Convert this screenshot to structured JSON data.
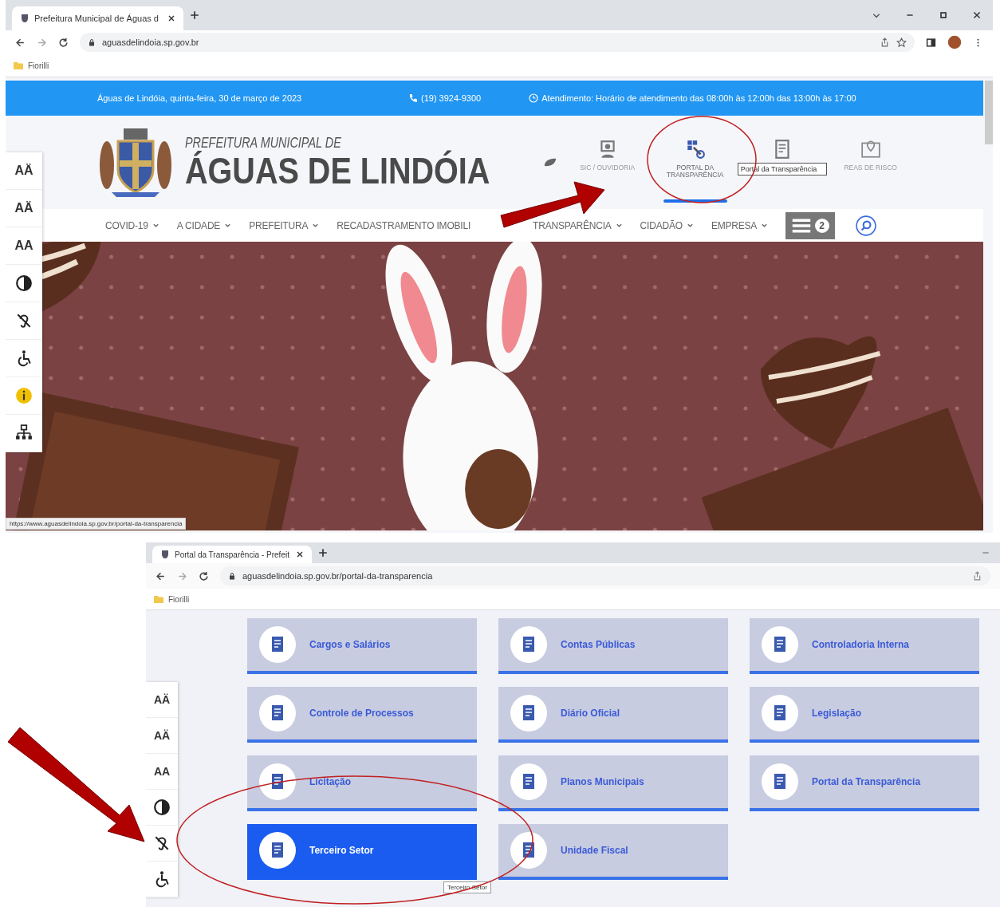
{
  "top_window": {
    "tab": {
      "title": "Prefeitura Municipal de Águas d"
    },
    "address_bar": {
      "url": "aguasdelindoia.sp.gov.br"
    },
    "bookmarks": [
      {
        "label": "Fiorilli"
      }
    ],
    "info_bar": {
      "date": "Águas de Lindóia, quinta-feira, 30 de março de 2023",
      "phone": "(19) 3924-9300",
      "hours": "Atendimento: Horário de atendimento das 08:00h às 12:00h das 13:00h às 17:00"
    },
    "site_header": {
      "title_small": "PREFEITURA MUNICIPAL DE",
      "title_large": "ÁGUAS DE LINDÓIA",
      "shortcuts": [
        {
          "kind": "headset",
          "label": "SIC / OUVIDORIA",
          "selected": false
        },
        {
          "kind": "transparency",
          "label": "PORTAL DA TRANSPARÊNCIA",
          "selected": true
        },
        {
          "kind": "map",
          "label": "REAS DE RISCO",
          "selected": false
        }
      ],
      "tooltip": "Portal da Transparência"
    },
    "nav": {
      "items": [
        {
          "label": "COVID-19",
          "dropdown": true
        },
        {
          "label": "A CIDADE",
          "dropdown": true
        },
        {
          "label": "PREFEITURA",
          "dropdown": true
        },
        {
          "label": "RECADASTRAMENTO IMOBILI",
          "dropdown": false
        },
        {
          "label": "TRANSPARÊNCIA",
          "dropdown": true
        },
        {
          "label": "CIDADÃO",
          "dropdown": true
        },
        {
          "label": "EMPRESA",
          "dropdown": true
        }
      ],
      "badge": "2"
    },
    "accessibility_buttons": [
      {
        "kind": "text",
        "label": "AÄ"
      },
      {
        "kind": "text",
        "label": "AÄ"
      },
      {
        "kind": "text",
        "label": "AA"
      },
      {
        "kind": "contrast"
      },
      {
        "kind": "hearing"
      },
      {
        "kind": "wheelchair"
      },
      {
        "kind": "info"
      },
      {
        "kind": "sitemap"
      }
    ],
    "status_url": "https://www.aguasdelindoia.sp.gov.br/portal-da-transparencia"
  },
  "bottom_window": {
    "tab": {
      "title": "Portal da Transparência - Prefeit"
    },
    "address_bar": {
      "url": "aguasdelindoia.sp.gov.br/portal-da-transparencia"
    },
    "bookmarks": [
      {
        "label": "Fiorilli"
      }
    ],
    "accessibility_buttons": [
      {
        "kind": "text",
        "label": "AÄ"
      },
      {
        "kind": "text",
        "label": "AÄ"
      },
      {
        "kind": "text",
        "label": "AA"
      },
      {
        "kind": "contrast"
      },
      {
        "kind": "hearing"
      },
      {
        "kind": "wheelchair"
      }
    ],
    "tiles": [
      {
        "label": "Cargos e Salários",
        "selected": false
      },
      {
        "label": "Contas Públicas",
        "selected": false
      },
      {
        "label": "Controladoria Interna",
        "selected": false
      },
      {
        "label": "Controle de Processos",
        "selected": false
      },
      {
        "label": "Diário Oficial",
        "selected": false
      },
      {
        "label": "Legislação",
        "selected": false
      },
      {
        "label": "Licitação",
        "selected": false
      },
      {
        "label": "Planos Municipais",
        "selected": false
      },
      {
        "label": "Portal da Transparência",
        "selected": false
      },
      {
        "label": "Terceiro Setor",
        "selected": true
      },
      {
        "label": "Unidade Fiscal",
        "selected": false
      }
    ],
    "tooltip": "Terceiro Setor"
  }
}
